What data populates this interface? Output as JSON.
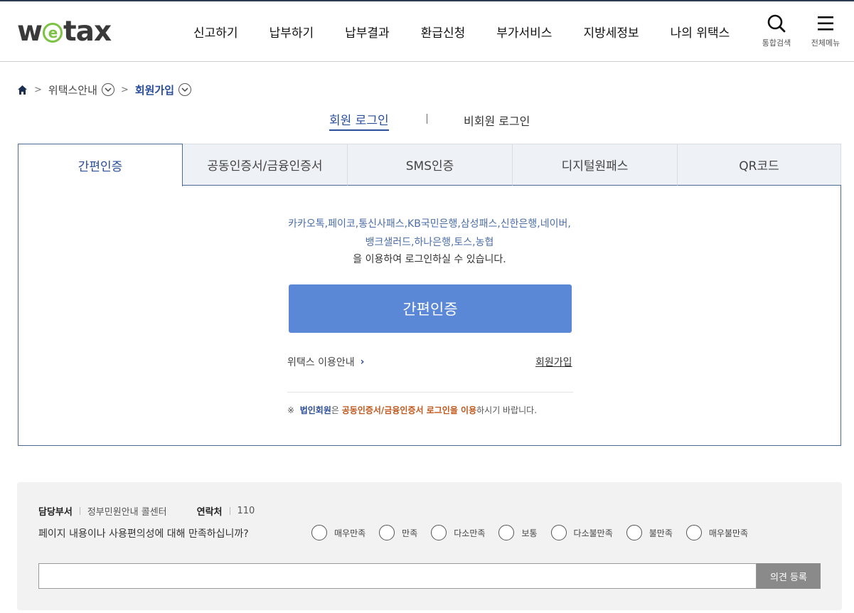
{
  "brand": {
    "logo_pre": "w",
    "logo_e": "e",
    "logo_post": "tax",
    "accent": "#7cc243"
  },
  "nav": {
    "items": [
      "신고하기",
      "납부하기",
      "납부결과",
      "환급신청",
      "부가서비스",
      "지방세정보",
      "나의 위택스"
    ],
    "search_label": "통합검색",
    "menu_label": "전체메뉴"
  },
  "breadcrumb": {
    "home_icon": "home-icon",
    "items": [
      "위택스안내",
      "회원가입"
    ]
  },
  "member_switch": {
    "member": "회원 로그인",
    "guest": "비회원 로그인"
  },
  "tabs": [
    "간편인증",
    "공동인증서/금융인증서",
    "SMS인증",
    "디지털원패스",
    "QR코드"
  ],
  "panel": {
    "providers_line1": "카카오톡,페이코,통신사패스,KB국민은행,삼성패스,신한은행,네이버,",
    "providers_line2": "뱅크샐러드,하나은행,토스,농협",
    "providers_note": "을 이용하여 로그인하실 수 있습니다.",
    "button": "간편인증",
    "guide_link": "위택스 이용안내",
    "join_link": "회원가입",
    "notice_mark": "※",
    "notice_part1": "법인회원",
    "notice_part2": "은 ",
    "notice_part3": "공동인증서/금융인증서 로그인을 이용",
    "notice_part4": "하시기 바랍니다."
  },
  "survey": {
    "dept_label": "담당부서",
    "dept_value": "정부민원안내 콜센터",
    "contact_label": "연락처",
    "contact_value": "110",
    "question": "페이지 내용이나 사용편의성에 대해 만족하십니까?",
    "options": [
      "매우만족",
      "만족",
      "다소만족",
      "보통",
      "다소불만족",
      "불만족",
      "매우불만족"
    ],
    "submit": "의견 등록"
  },
  "colors": {
    "primary": "#2a4e9a",
    "button": "#5a87d6",
    "highlight": "#c0571b"
  }
}
